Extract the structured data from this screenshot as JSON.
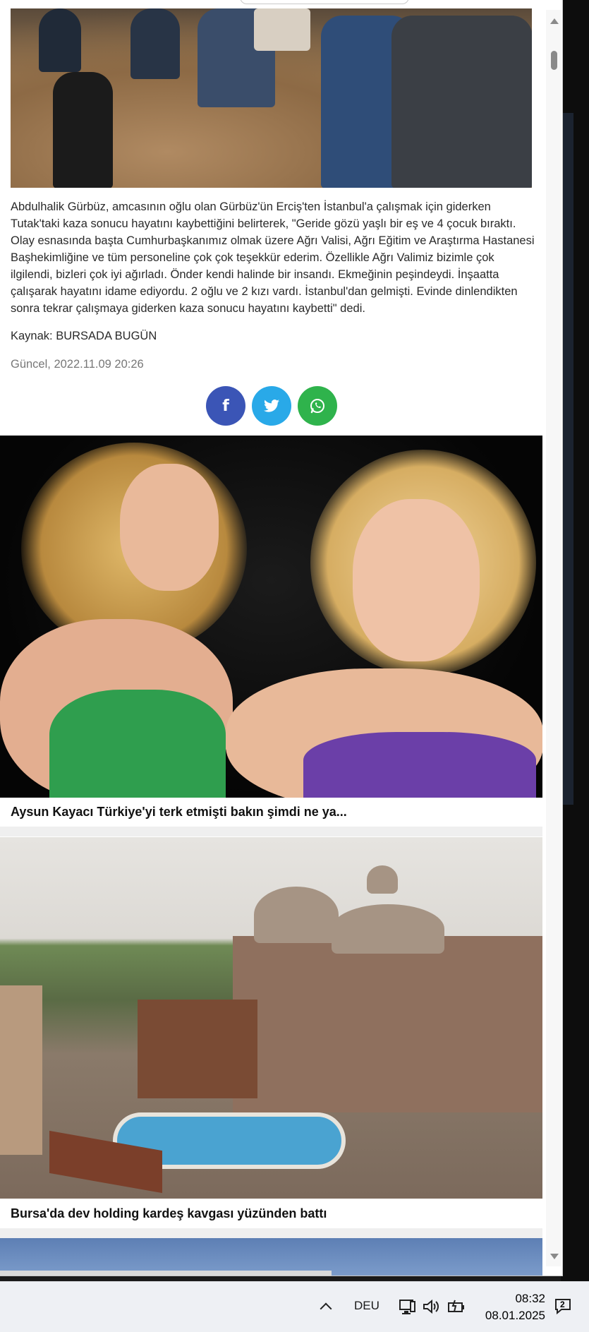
{
  "article": {
    "body": "Abdulhalik Gürbüz, amcasının oğlu olan Gürbüz'ün Erciş'ten İstanbul'a çalışmak için giderken Tutak'taki kaza sonucu hayatını kaybettiğini belirterek, \"Geride gözü yaşlı bir eş ve 4 çocuk bıraktı. Olay esnasında başta Cumhurbaşkanımız olmak üzere Ağrı Valisi, Ağrı Eğitim ve Araştırma Hastanesi Başhekimliğine ve tüm personeline çok çok teşekkür ederim. Özellikle Ağrı Valimiz bizimle çok ilgilendi, bizleri çok iyi ağırladı. Önder kendi halinde bir insandı. Ekmeğinin peşindeydi. İnşaatta çalışarak hayatını idame ediyordu. 2 oğlu ve 2 kızı vardı. İstanbul'dan gelmişti. Evinde dinlendikten sonra tekrar çalışmaya giderken kaza sonucu hayatını kaybetti\" dedi.",
    "source": "Kaynak: BURSADA BUGÜN",
    "updated": "Güncel, 2022.11.09 20:26"
  },
  "share": {
    "facebook": "f",
    "twitter": "twitter-bird-icon",
    "whatsapp": "whatsapp-icon"
  },
  "related": [
    {
      "title": "Aysun Kayacı Türkiye'yi terk etmişti bakın şimdi ne ya..."
    },
    {
      "title": "Bursa'da dev holding kardeş kavgası yüzünden battı"
    }
  ],
  "taskbar": {
    "language": "DEU",
    "time": "08:32",
    "date": "08.01.2025",
    "notification_badge": "2"
  },
  "colors": {
    "facebook": "#3b55b6",
    "twitter": "#29a9e8",
    "whatsapp": "#2fb34c"
  }
}
